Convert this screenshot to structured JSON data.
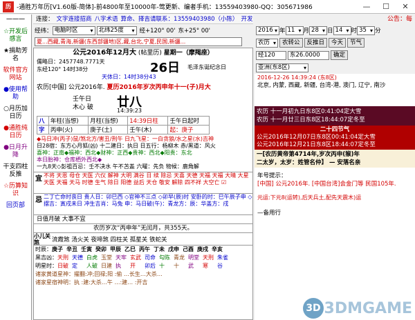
{
  "window": {
    "title": "-通胜万年历[V1.60版-简体]-前4800年至10000年-莺更新、编者手机：13559403980-QQ：305671986",
    "min": "—",
    "max": "☐",
    "close": "✕"
  },
  "sidebar": {
    "items": [
      {
        "label": "一一一",
        "color": "#000"
      },
      {
        "label": "☆开发后感言",
        "color": "#007a00"
      },
      {
        "label": "★捐助芳名",
        "color": "#000"
      },
      {
        "label": "软件官方网站",
        "color": "#d40000"
      },
      {
        "label": "●使用帮助",
        "color": "#0000cc"
      },
      {
        "label": "○月历加日历",
        "color": "#000"
      },
      {
        "label": "●通胜纯日历",
        "color": "#d40000"
      },
      {
        "label": "●日月升降",
        "color": "#800080"
      },
      {
        "label": "干支四柱反推",
        "color": "#000"
      },
      {
        "label": "☆历算知识",
        "color": "#d40000"
      },
      {
        "label": "回页部",
        "color": "#0000cc"
      }
    ]
  },
  "links": {
    "prefix": "连接：",
    "items": [
      "文字连接招商",
      "八字术语",
      "算命、择吉请联系：13559403980（小陈）",
      "开发资金捐助"
    ]
  },
  "location": {
    "label_city": "经纬：",
    "city": "电脑时区",
    "lat": "北纬25度",
    "lon_time": "经+120° 00'",
    "zone": "东+25° 00'",
    "region": "夏...西藏,青海,新疆(东西部疆地)区,藏,台北,宁夏,民国,新疆..."
  },
  "header": {
    "gregorian": "公元2016年12月大",
    "badge": "(帖里历)",
    "weekday": "星期一（摩羯座）",
    "day": "26日",
    "note": "毛泽东诞纪念日",
    "julian": "儒略日：2457748.7771天",
    "jie": "东经120° 14时38分",
    "tianwen": "天体日：14时38分43",
    "lunar": "农历[中国] 公元2016年.",
    "lunar_year": "夏历2016年岁次丙申年十一(子)月大"
  },
  "pillars": {
    "labels": [
      "壬午日",
      "木心 破"
    ],
    "day_big": "廿八",
    "time": "14:39:23",
    "rows": [
      {
        "a": "八",
        "b": "年柱(当想)",
        "c": "月柱(当想)",
        "d": "14:39日柱",
        "e": "壬午日起时"
      },
      {
        "a": "字",
        "b": "丙申(火)",
        "c": "庚子(土)",
        "d": "壬午(木)",
        "e": "起：庚子"
      }
    ]
  },
  "lines": [
    "◆马日冲(丙子)鼠/煞北方/害丑/刑午 日九飞星：一白贪狼/水之星(水)吉神",
    "日28宿：东方心月狐(凶) 十二建日：执日 日五行：杨柳木 赤/黑道：风火",
    "喜神：正南◆福神：西北◆财神：正西◆贵神：西北◆阳贵：东北",
    "本日胎神：仓库栖外西北◆",
    "一九8天◇彭祖百忌：壬不决水 午不苫盖 六曜：先负 物候：鹿角解"
  ],
  "yi": {
    "label": "宜",
    "text": "不将 天恩 母仓 天医 六仪 解神 大明 满谷 日 续 除忌 天喜 天德 天福 天福 大晴 大星 天医 天福 天马 时德 生气 除日 阳德 益后 天仓 敬安 解除 四不祥 大空亡 ☑"
  },
  "ji": {
    "label": "忌",
    "text": "二丁亡命时丧日 贵人日：卯巳西 ◇官神不三点 ◇卯早(辰)时 安卧的时：巳午辰子申 ◇摆吉：寅戌未日 冲生吉肖：马兔 申：马日破(午)：青龙方：辰：华盖方：戌"
  },
  "bad": "日值月破 大事不宜",
  "nongli_note": "农历岁次“丙申年”无闰月，共355天。",
  "xiaoer": {
    "label": "小儿关煞",
    "text": "流霞煞 汤火关 夜啼煞 四柱关 孤星关 铁蛇关"
  },
  "shichen": {
    "row1_label": "时辰：",
    "row1": [
      "庚子",
      "辛丑",
      "壬寅",
      "癸卯",
      "甲辰",
      "乙巳",
      "丙午",
      "丁未",
      "戊申",
      "己酉",
      "庚戌",
      "辛亥"
    ],
    "row2_label": "黑吉凶：",
    "row2": [
      "天刑",
      "天德",
      "白虎",
      "玉堂",
      "天牢",
      "玄武",
      "司命",
      "勾陈",
      "青龙",
      "明堂",
      "天刑",
      "朱雀"
    ],
    "row3_label": "明星时：",
    "row3": [
      "日破",
      "定",
      "人破",
      "日建",
      "执",
      "开",
      "卯后",
      "十",
      "十",
      "武",
      "寒",
      "谷"
    ]
  },
  "lower_lines": [
    "诸家黄道星神：擢翻:冲;回禄;阳 :偷 …长生…大杀…",
    "诸家星宿神明：执 :建:大杀…午 …:建… :开吉"
  ],
  "date_ctrl": {
    "year": "2016",
    "year_suffix": "年",
    "month": "11",
    "month_suffix": "月",
    "day": "28",
    "day_suffix": "日",
    "hour": "14",
    "hour_suffix": "时",
    "minute": "35",
    "minute_suffix": "分",
    "notice": "公告：每"
  },
  "mode_ctrl": {
    "m1": "农历",
    "m2": "农转公",
    "m3": "反推日",
    "today": "今天",
    "jieqi": "节气"
  },
  "tz_ctrl": {
    "lon": "经120",
    "tz": "东26.0000",
    "ok": "确定"
  },
  "zone_ctrl": {
    "zone": "亚洲(东8区)",
    "date": "2016-12-26 14:39:24 (东8区)"
  },
  "cities": "北京, 内蒙, 西藏, 新疆, 台湾-港, 澳门, 辽宁, 南沙",
  "jieqi_box": {
    "l1": "农历 十一月初九日东8区0:41:04定大雪",
    "l2": "农历 十一月廿三日东8区18:44:07定冬至",
    "title": "二十四节气",
    "r1": "公元2016年12月07日东8区00:41:04定大雪",
    "r2": "公元2016年12月21日东8区18:44:07定冬至"
  },
  "ganzhi_box": {
    "l1": "一[农历黄帝第4714年,岁次丙申(猴)年",
    "l2": "二太岁，太岁：姓管名仲】 — 安落名亲"
  },
  "nianhao": {
    "label": "年号提示：",
    "text": "[中国] 公元2016年. [中国台湾]会金门等 民国105年."
  },
  "yuanhui": "元运:下元8(运转),后天兵土,配先天震木)运",
  "beiyong": "—备用行",
  "watermark": "3DMGAME"
}
